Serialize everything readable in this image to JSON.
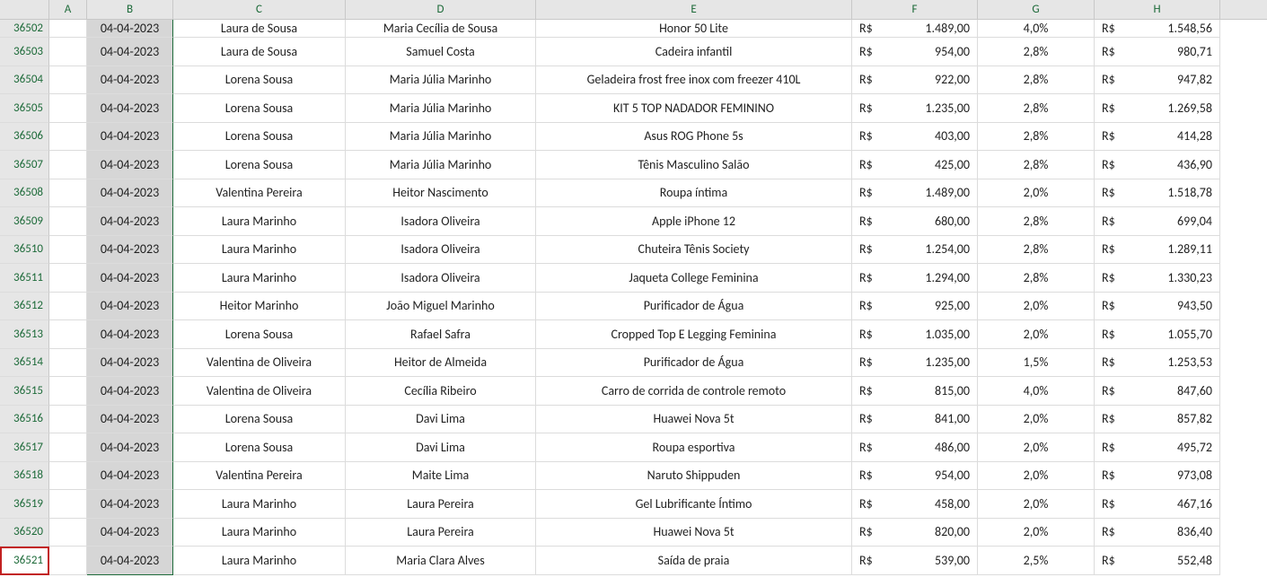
{
  "columns": [
    "A",
    "B",
    "C",
    "D",
    "E",
    "F",
    "G",
    "H"
  ],
  "currency_symbol": "R$",
  "selected_row_header": "36521",
  "rows": [
    {
      "n": "36502",
      "partial": true,
      "date": "04-04-2023",
      "c": "Laura de Sousa",
      "d": "Maria Cecília de Sousa",
      "e": "Honor 50 Lite",
      "f": "1.489,00",
      "g": "4,0%",
      "h": "1.548,56"
    },
    {
      "n": "36503",
      "date": "04-04-2023",
      "c": "Laura de Sousa",
      "d": "Samuel Costa",
      "e": "Cadeira infantil",
      "f": "954,00",
      "g": "2,8%",
      "h": "980,71"
    },
    {
      "n": "36504",
      "date": "04-04-2023",
      "c": "Lorena Sousa",
      "d": "Maria Júlia Marinho",
      "e": "Geladeira frost free inox com freezer 410L",
      "f": "922,00",
      "g": "2,8%",
      "h": "947,82"
    },
    {
      "n": "36505",
      "date": "04-04-2023",
      "c": "Lorena Sousa",
      "d": "Maria Júlia Marinho",
      "e": "KIT 5 TOP NADADOR FEMININO",
      "f": "1.235,00",
      "g": "2,8%",
      "h": "1.269,58"
    },
    {
      "n": "36506",
      "date": "04-04-2023",
      "c": "Lorena Sousa",
      "d": "Maria Júlia Marinho",
      "e": "Asus ROG Phone 5s",
      "f": "403,00",
      "g": "2,8%",
      "h": "414,28"
    },
    {
      "n": "36507",
      "date": "04-04-2023",
      "c": "Lorena Sousa",
      "d": "Maria Júlia Marinho",
      "e": "Tênis Masculino Salão",
      "f": "425,00",
      "g": "2,8%",
      "h": "436,90"
    },
    {
      "n": "36508",
      "date": "04-04-2023",
      "c": "Valentina Pereira",
      "d": "Heitor Nascimento",
      "e": "Roupa íntima",
      "f": "1.489,00",
      "g": "2,0%",
      "h": "1.518,78"
    },
    {
      "n": "36509",
      "date": "04-04-2023",
      "c": "Laura Marinho",
      "d": "Isadora Oliveira",
      "e": "Apple iPhone 12",
      "f": "680,00",
      "g": "2,8%",
      "h": "699,04"
    },
    {
      "n": "36510",
      "date": "04-04-2023",
      "c": "Laura Marinho",
      "d": "Isadora Oliveira",
      "e": "Chuteira Tênis Society",
      "f": "1.254,00",
      "g": "2,8%",
      "h": "1.289,11"
    },
    {
      "n": "36511",
      "date": "04-04-2023",
      "c": "Laura Marinho",
      "d": "Isadora Oliveira",
      "e": "Jaqueta College Feminina",
      "f": "1.294,00",
      "g": "2,8%",
      "h": "1.330,23"
    },
    {
      "n": "36512",
      "date": "04-04-2023",
      "c": "Heitor Marinho",
      "d": "João Miguel Marinho",
      "e": "Purificador de Água",
      "f": "925,00",
      "g": "2,0%",
      "h": "943,50"
    },
    {
      "n": "36513",
      "date": "04-04-2023",
      "c": "Lorena Sousa",
      "d": "Rafael Safra",
      "e": "Cropped Top E Legging Feminina",
      "f": "1.035,00",
      "g": "2,0%",
      "h": "1.055,70"
    },
    {
      "n": "36514",
      "date": "04-04-2023",
      "c": "Valentina de Oliveira",
      "d": "Heitor de Almeida",
      "e": "Purificador de Água",
      "f": "1.235,00",
      "g": "1,5%",
      "h": "1.253,53"
    },
    {
      "n": "36515",
      "date": "04-04-2023",
      "c": "Valentina de Oliveira",
      "d": "Cecília Ribeiro",
      "e": "Carro de corrida de controle remoto",
      "f": "815,00",
      "g": "4,0%",
      "h": "847,60"
    },
    {
      "n": "36516",
      "date": "04-04-2023",
      "c": "Lorena Sousa",
      "d": "Davi Lima",
      "e": "Huawei Nova 5t",
      "f": "841,00",
      "g": "2,0%",
      "h": "857,82"
    },
    {
      "n": "36517",
      "date": "04-04-2023",
      "c": "Lorena Sousa",
      "d": "Davi Lima",
      "e": "Roupa esportiva",
      "f": "486,00",
      "g": "2,0%",
      "h": "495,72"
    },
    {
      "n": "36518",
      "date": "04-04-2023",
      "c": "Valentina Pereira",
      "d": "Maite Lima",
      "e": "Naruto Shippuden",
      "f": "954,00",
      "g": "2,0%",
      "h": "973,08"
    },
    {
      "n": "36519",
      "date": "04-04-2023",
      "c": "Laura Marinho",
      "d": "Laura Pereira",
      "e": "Gel Lubrificante Íntimo",
      "f": "458,00",
      "g": "2,0%",
      "h": "467,16"
    },
    {
      "n": "36520",
      "date": "04-04-2023",
      "c": "Laura Marinho",
      "d": "Laura Pereira",
      "e": "Huawei Nova 5t",
      "f": "820,00",
      "g": "2,0%",
      "h": "836,40"
    },
    {
      "n": "36521",
      "date": "04-04-2023",
      "c": "Laura Marinho",
      "d": "Maria Clara Alves",
      "e": "Saída de praia",
      "f": "539,00",
      "g": "2,5%",
      "h": "552,48",
      "last": true
    }
  ]
}
